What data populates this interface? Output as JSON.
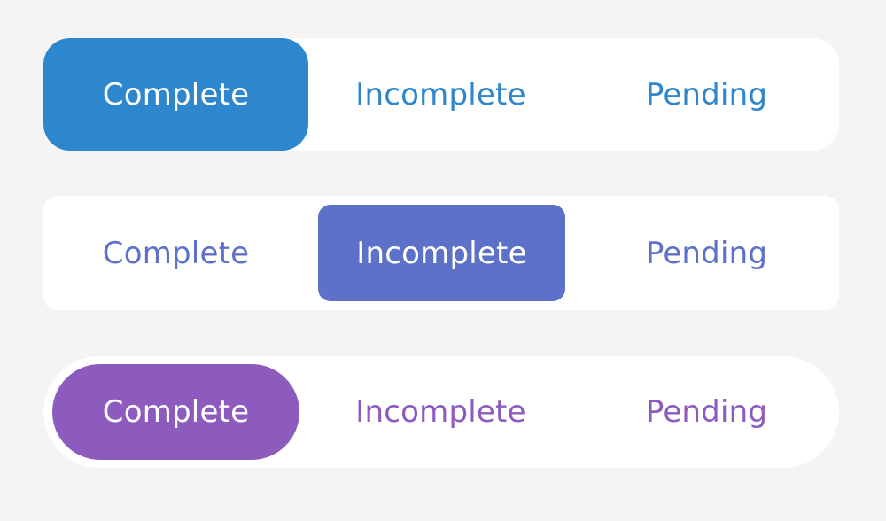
{
  "controls": [
    {
      "style": "rounded",
      "accent_color": "#2e86cc",
      "selected_index": 0,
      "segments": [
        "Complete",
        "Incomplete",
        "Pending"
      ]
    },
    {
      "style": "inset-rounded",
      "accent_color": "#5c71c7",
      "selected_index": 1,
      "segments": [
        "Complete",
        "Incomplete",
        "Pending"
      ]
    },
    {
      "style": "inset-pill",
      "accent_color": "#8d5bbd",
      "selected_index": 0,
      "segments": [
        "Complete",
        "Incomplete",
        "Pending"
      ]
    }
  ]
}
